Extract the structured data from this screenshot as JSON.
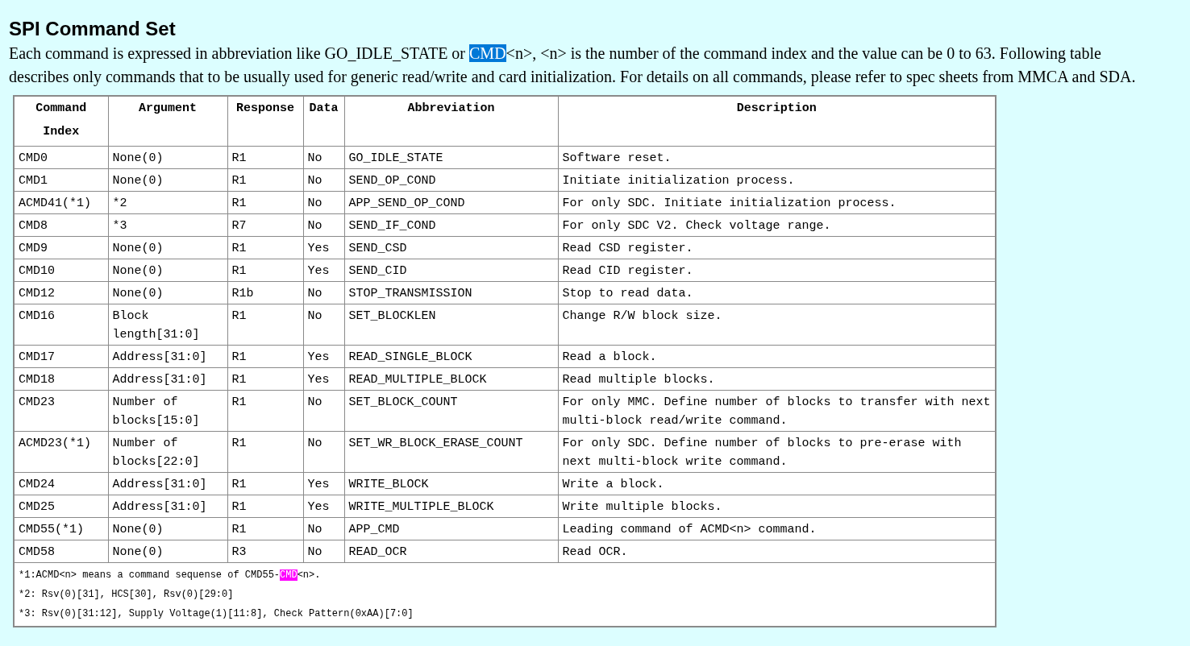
{
  "heading": "SPI Command Set",
  "intro": {
    "before": "Each command is expressed in abbreviation like GO_IDLE_STATE or ",
    "highlight": "CMD",
    "after": "<n>, <n> is the number of the command index and the value can be 0 to 63. Following table describes only commands that to be usually used for generic read/write and card initialization. For details on all commands, please refer to spec sheets from MMCA and SDA."
  },
  "table": {
    "columns": [
      "Command Index",
      "Argument",
      "Response",
      "Data",
      "Abbreviation",
      "Description"
    ],
    "rows": [
      [
        "CMD0",
        "None(0)",
        "R1",
        "No",
        "GO_IDLE_STATE",
        "Software reset."
      ],
      [
        "CMD1",
        "None(0)",
        "R1",
        "No",
        "SEND_OP_COND",
        "Initiate initialization process."
      ],
      [
        "ACMD41(*1)",
        "*2",
        "R1",
        "No",
        "APP_SEND_OP_COND",
        "For only SDC. Initiate initialization process."
      ],
      [
        "CMD8",
        "*3",
        "R7",
        "No",
        "SEND_IF_COND",
        "For only SDC V2. Check voltage range."
      ],
      [
        "CMD9",
        "None(0)",
        "R1",
        "Yes",
        "SEND_CSD",
        "Read CSD register."
      ],
      [
        "CMD10",
        "None(0)",
        "R1",
        "Yes",
        "SEND_CID",
        "Read CID register."
      ],
      [
        "CMD12",
        "None(0)",
        "R1b",
        "No",
        "STOP_TRANSMISSION",
        "Stop to read data."
      ],
      [
        "CMD16",
        "Block length[31:0]",
        "R1",
        "No",
        "SET_BLOCKLEN",
        "Change R/W block size."
      ],
      [
        "CMD17",
        "Address[31:0]",
        "R1",
        "Yes",
        "READ_SINGLE_BLOCK",
        "Read a block."
      ],
      [
        "CMD18",
        "Address[31:0]",
        "R1",
        "Yes",
        "READ_MULTIPLE_BLOCK",
        "Read multiple blocks."
      ],
      [
        "CMD23",
        "Number of blocks[15:0]",
        "R1",
        "No",
        "SET_BLOCK_COUNT",
        "For only MMC. Define number of blocks to transfer with next multi-block read/write command."
      ],
      [
        "ACMD23(*1)",
        "Number of blocks[22:0]",
        "R1",
        "No",
        "SET_WR_BLOCK_ERASE_COUNT",
        "For only SDC. Define number of blocks to pre-erase with next multi-block write command."
      ],
      [
        "CMD24",
        "Address[31:0]",
        "R1",
        "Yes",
        "WRITE_BLOCK",
        "Write a block."
      ],
      [
        "CMD25",
        "Address[31:0]",
        "R1",
        "Yes",
        "WRITE_MULTIPLE_BLOCK",
        "Write multiple blocks."
      ],
      [
        "CMD55(*1)",
        "None(0)",
        "R1",
        "No",
        "APP_CMD",
        "Leading command of ACMD<n> command."
      ],
      [
        "CMD58",
        "None(0)",
        "R3",
        "No",
        "READ_OCR",
        "Read OCR."
      ]
    ],
    "footnotes": [
      {
        "before": "*1:ACMD<n> means a command sequense of CMD55-",
        "highlight": "CMD",
        "after": "<n>."
      },
      {
        "before": "*2: Rsv(0)[31], HCS[30], Rsv(0)[29:0]"
      },
      {
        "before": "*3: Rsv(0)[31:12], Supply Voltage(1)[11:8], Check Pattern(0xAA)[7:0]"
      }
    ]
  }
}
